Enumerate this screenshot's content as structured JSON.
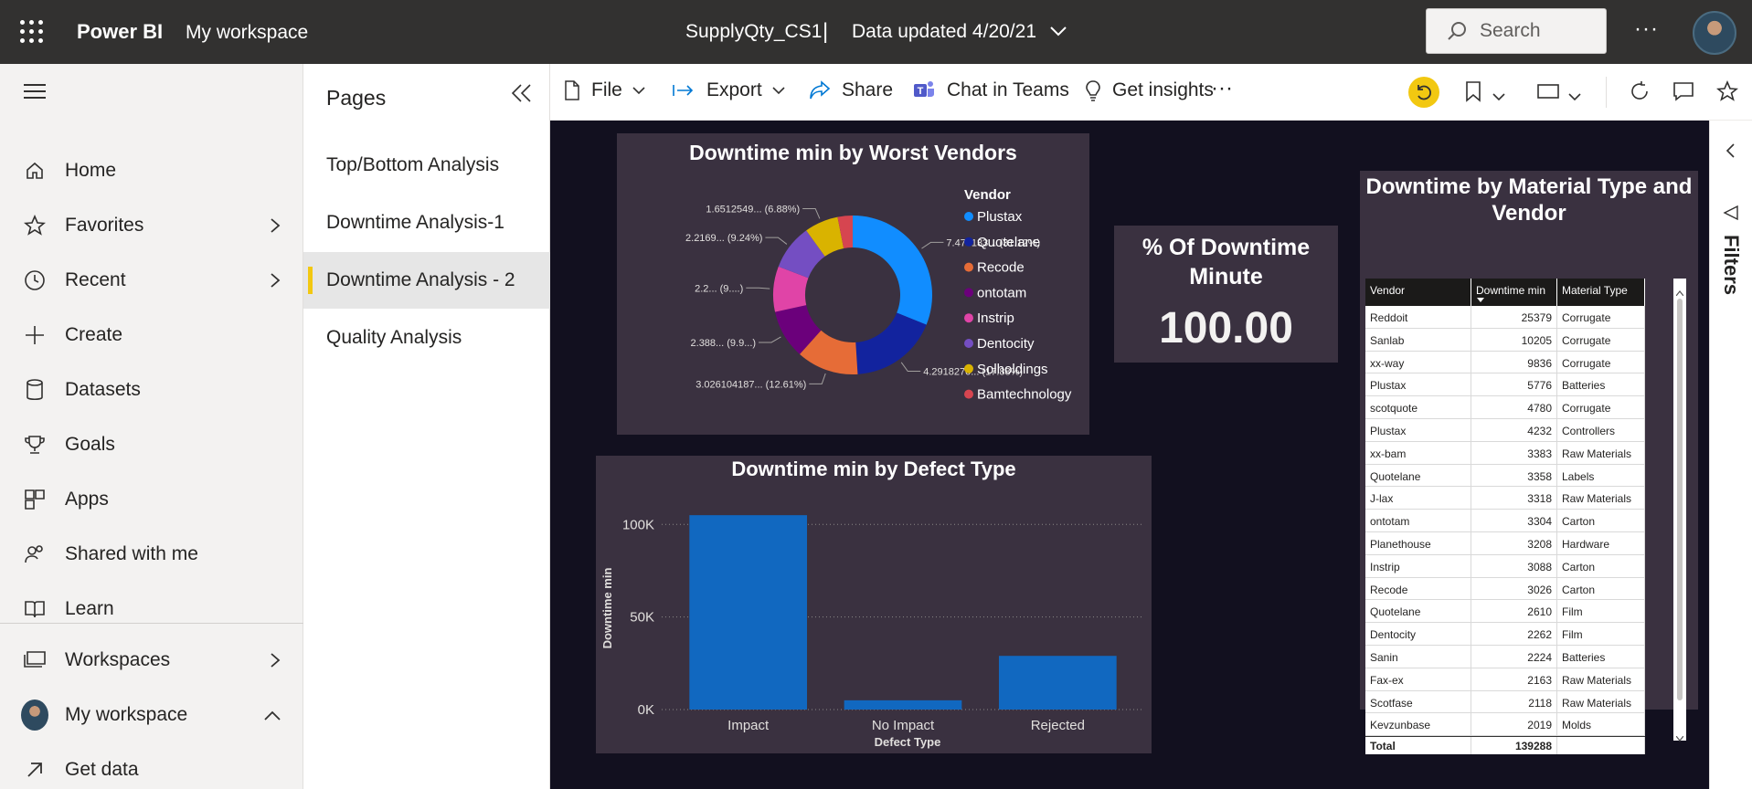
{
  "header": {
    "brand": "Power BI",
    "workspace": "My workspace",
    "report_title": "SupplyQty_CS1",
    "separator": "|",
    "updated": "Data updated 4/20/21",
    "search_placeholder": "Search",
    "more": "···"
  },
  "nav": {
    "items": [
      {
        "label": "Home",
        "icon": "home-icon"
      },
      {
        "label": "Favorites",
        "icon": "star-icon"
      },
      {
        "label": "Recent",
        "icon": "clock-icon"
      },
      {
        "label": "Create",
        "icon": "plus-icon"
      },
      {
        "label": "Datasets",
        "icon": "database-icon"
      },
      {
        "label": "Goals",
        "icon": "trophy-icon"
      },
      {
        "label": "Apps",
        "icon": "apps-icon"
      },
      {
        "label": "Shared with me",
        "icon": "shared-icon"
      },
      {
        "label": "Learn",
        "icon": "book-icon"
      }
    ],
    "workspaces": "Workspaces",
    "my_workspace": "My workspace",
    "get_data": "Get data"
  },
  "pages": {
    "title": "Pages",
    "items": [
      "Top/Bottom Analysis",
      "Downtime Analysis-1",
      "Downtime Analysis - 2",
      "Quality Analysis"
    ],
    "active_index": 2
  },
  "toolbar": {
    "file": "File",
    "export": "Export",
    "share": "Share",
    "chat": "Chat in Teams",
    "insights": "Get insights",
    "more": "···"
  },
  "filters_label": "Filters",
  "colors": {
    "accent": "#f2c811",
    "bar": "#1168c0",
    "canvas": "#12101f",
    "card": "#3a3140"
  },
  "kpi": {
    "title": "% Of Downtime Minute",
    "value": "100.00"
  },
  "chart_data": [
    {
      "type": "pie",
      "title": "Downtime min by Worst Vendors",
      "legend_title": "Vendor",
      "legend_position": "right",
      "slices": [
        {
          "name": "Plustax",
          "percent": 31.12,
          "label": "7.470133... (31.12%)",
          "color": "#118dff"
        },
        {
          "name": "Quotelane",
          "percent": 17.88,
          "label": "4.2918270... (17.88%)",
          "color": "#12239e"
        },
        {
          "name": "Recode",
          "percent": 12.61,
          "label": "3.026104187... (12.61%)",
          "color": "#e66c37"
        },
        {
          "name": "ontotam",
          "percent": 9.95,
          "label": "2.388... (9.9...)",
          "color": "#6b007b"
        },
        {
          "name": "Instrip",
          "percent": 9.27,
          "label": "2.2... (9....)",
          "color": "#e044a7"
        },
        {
          "name": "Dentocity",
          "percent": 9.24,
          "label": "2.2169... (9.24%)",
          "color": "#744ec2"
        },
        {
          "name": "Solholdings",
          "percent": 6.88,
          "label": "1.6512549... (6.88%)",
          "color": "#d9b300"
        },
        {
          "name": "Bamtechnology",
          "percent": 3.05,
          "label": "",
          "color": "#d64550"
        }
      ]
    },
    {
      "type": "bar",
      "title": "Downtime min by Defect Type",
      "categories": [
        "Impact",
        "No Impact",
        "Rejected"
      ],
      "values": [
        105000,
        5000,
        29000
      ],
      "xlabel": "Defect Type",
      "ylabel": "Downtime min",
      "ylim": [
        0,
        110000
      ],
      "yticks": [
        "0K",
        "50K",
        "100K"
      ],
      "ytick_values": [
        0,
        50000,
        100000
      ]
    },
    {
      "type": "table",
      "title": "Downtime by Material Type and Vendor",
      "columns": [
        "Vendor",
        "Downtime min",
        "Material Type"
      ],
      "rows": [
        [
          "Reddoit",
          "25379",
          "Corrugate"
        ],
        [
          "Sanlab",
          "10205",
          "Corrugate"
        ],
        [
          "xx-way",
          "9836",
          "Corrugate"
        ],
        [
          "Plustax",
          "5776",
          "Batteries"
        ],
        [
          "scotquote",
          "4780",
          "Corrugate"
        ],
        [
          "Plustax",
          "4232",
          "Controllers"
        ],
        [
          "xx-bam",
          "3383",
          "Raw Materials"
        ],
        [
          "Quotelane",
          "3358",
          "Labels"
        ],
        [
          "J-lax",
          "3318",
          "Raw Materials"
        ],
        [
          "ontotam",
          "3304",
          "Carton"
        ],
        [
          "Planethouse",
          "3208",
          "Hardware"
        ],
        [
          "Instrip",
          "3088",
          "Carton"
        ],
        [
          "Recode",
          "3026",
          "Carton"
        ],
        [
          "Quotelane",
          "2610",
          "Film"
        ],
        [
          "Dentocity",
          "2262",
          "Film"
        ],
        [
          "Sanin",
          "2224",
          "Batteries"
        ],
        [
          "Fax-ex",
          "2163",
          "Raw Materials"
        ],
        [
          "Scotfase",
          "2118",
          "Raw Materials"
        ],
        [
          "Kevzunbase",
          "2019",
          "Molds"
        ]
      ],
      "total": [
        "Total",
        "139288",
        ""
      ]
    }
  ]
}
